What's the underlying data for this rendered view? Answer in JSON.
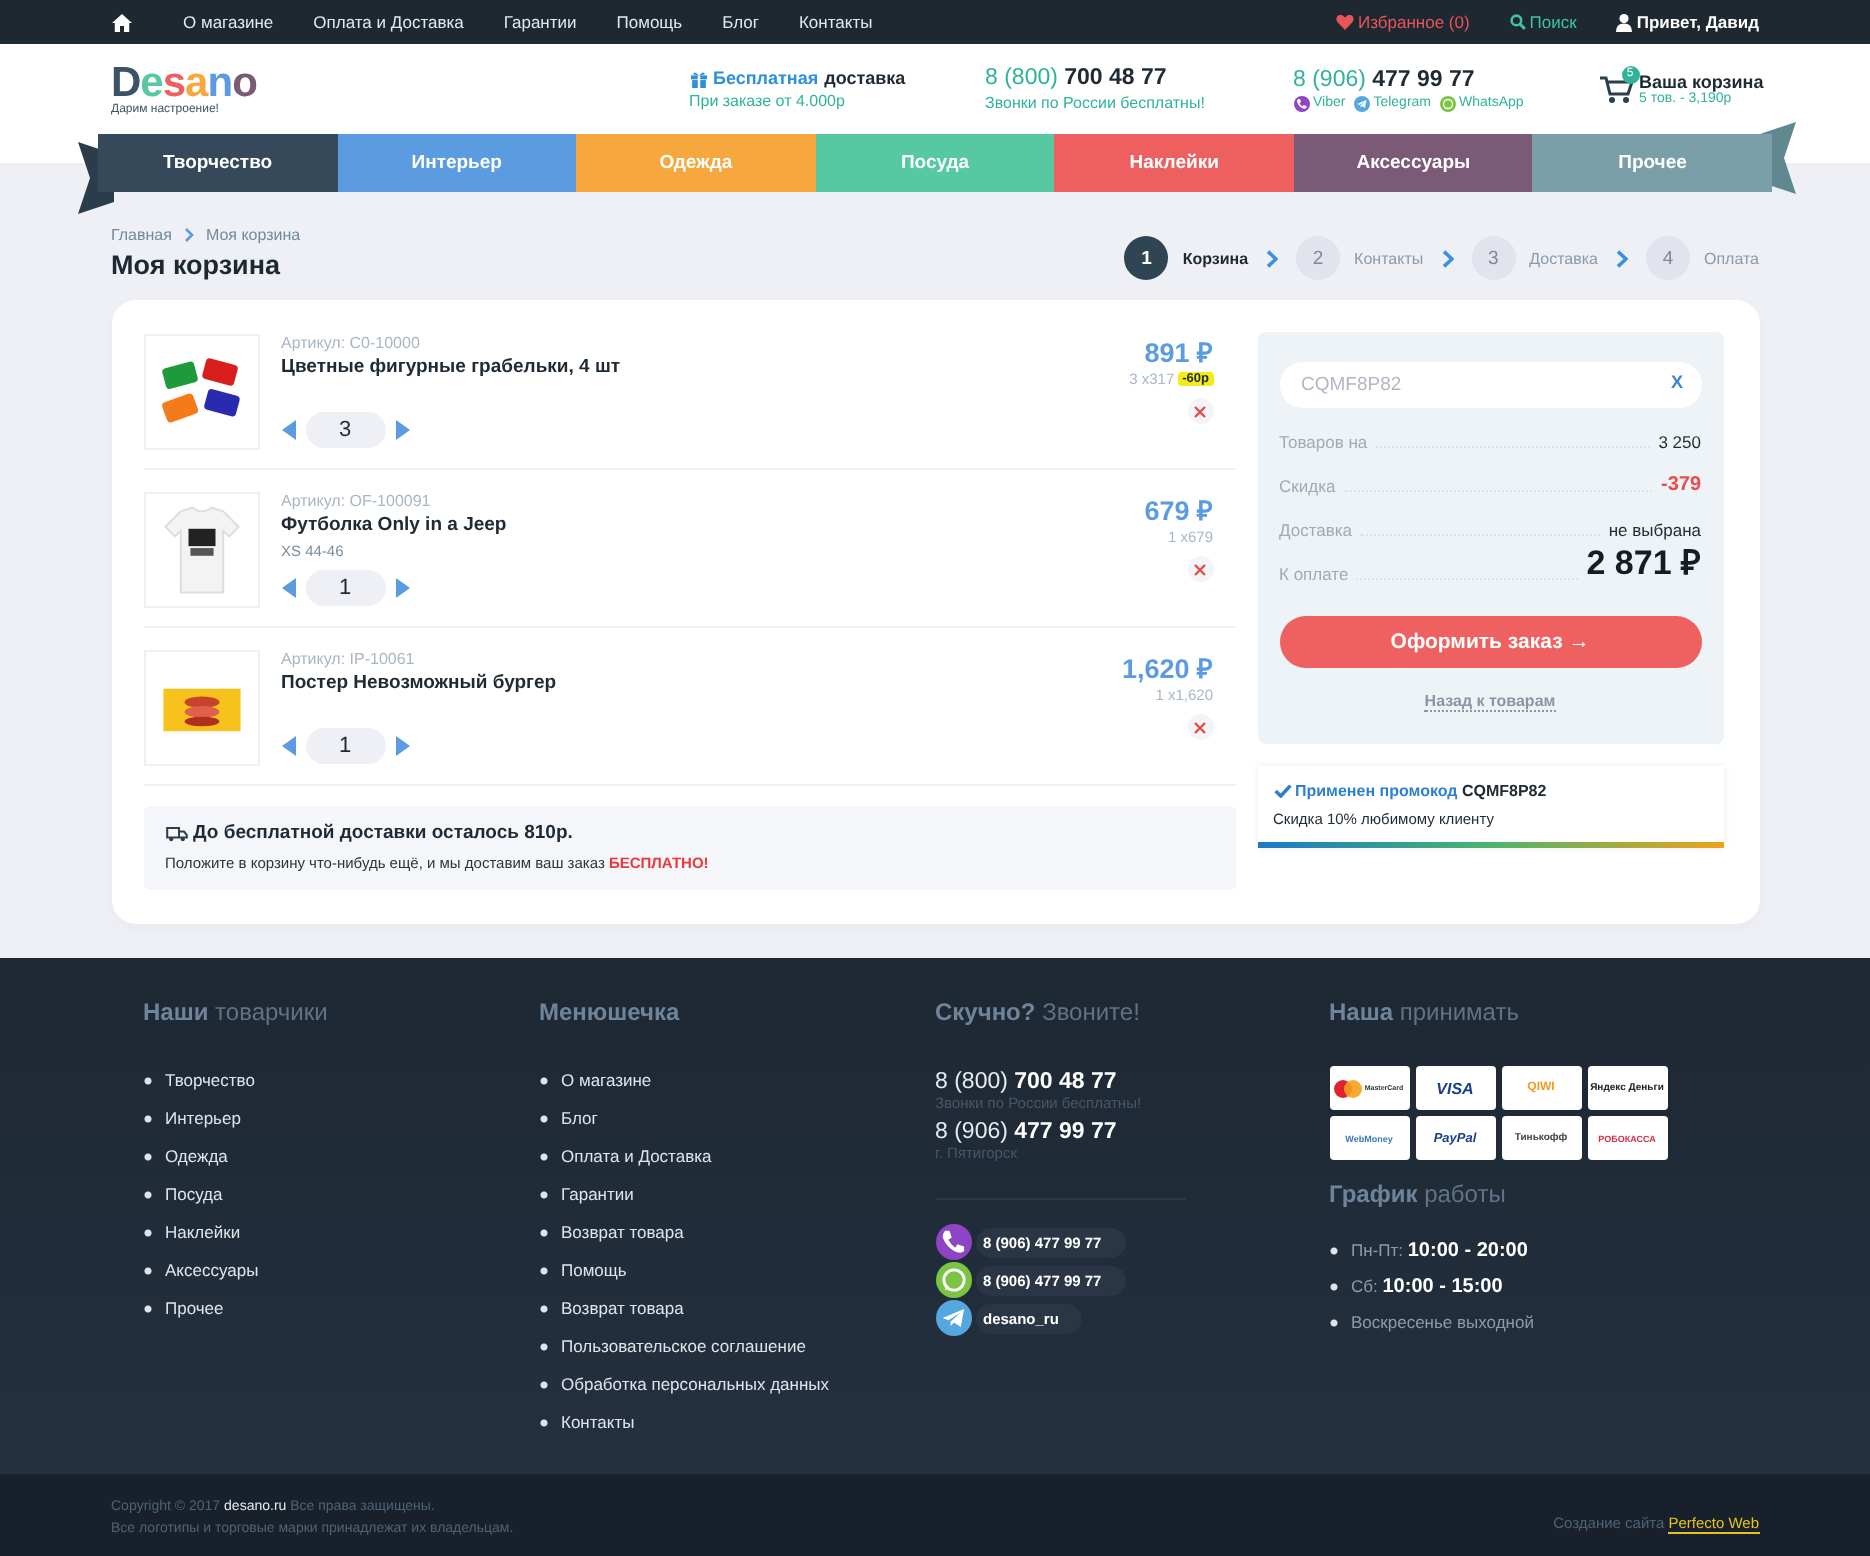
{
  "topbar": {
    "links": [
      {
        "label": "О магазине"
      },
      {
        "label": "Оплата и Доставка"
      },
      {
        "label": "Гарантии"
      },
      {
        "label": "Помощь"
      },
      {
        "label": "Блог"
      },
      {
        "label": "Контакты"
      }
    ],
    "favorites": "Избранное (0)",
    "search": "Поиск",
    "user": "Привет, Давид"
  },
  "header": {
    "logo": {
      "name": "Desano",
      "tagline": "Дарим настроение!"
    },
    "delivery": {
      "accent": "Бесплатная",
      "rest": "доставка",
      "note": "При заказе от 4.000р"
    },
    "phones": [
      {
        "number": "8 (800) **700 48 77**",
        "note": "Звонки по России бесплатны!"
      },
      {
        "number": "8 (906) **477 99 77**",
        "messengers": [
          {
            "kind": "viber",
            "label": "Viber"
          },
          {
            "kind": "telegram",
            "label": "Telegram"
          },
          {
            "kind": "whatsapp",
            "label": "WhatsApp"
          }
        ]
      }
    ],
    "cart": {
      "title": "Ваша корзина",
      "count": "5",
      "summary": "5 тов. - 3,190р"
    }
  },
  "categories": [
    {
      "label": "Творчество",
      "color": "#35495a"
    },
    {
      "label": "Интерьер",
      "color": "#5b9be0"
    },
    {
      "label": "Одежда",
      "color": "#f6a73d"
    },
    {
      "label": "Посуда",
      "color": "#56c8a2"
    },
    {
      "label": "Наклейки",
      "color": "#ee6060"
    },
    {
      "label": "Аксессуары",
      "color": "#7b5a77"
    },
    {
      "label": "Прочее",
      "color": "#7a9fa8"
    }
  ],
  "breadcrumbs": [
    {
      "label": "Главная"
    },
    {
      "label": "Моя корзина"
    }
  ],
  "page_title": "Моя корзина",
  "steps": [
    {
      "number": "1",
      "label": "Корзина",
      "selected": true
    },
    {
      "number": "2",
      "label": "Контакты",
      "selected": false
    },
    {
      "number": "3",
      "label": "Доставка",
      "selected": false
    },
    {
      "number": "4",
      "label": "Оплата",
      "selected": false
    }
  ],
  "cart_items": [
    {
      "sku": "Артикул: C0-10000",
      "name": "Цветные фигурные грабельки, 4 шт",
      "quantity": "3",
      "price": "891 ₽",
      "unit": "3 x317",
      "discount": "-60р"
    },
    {
      "sku": "Артикул: OF-100091",
      "name": "Футболка Only in a Jeep",
      "variant": "XS 44-46",
      "quantity": "1",
      "price": "679 ₽",
      "unit": "1 x679"
    },
    {
      "sku": "Артикул: IP-10061",
      "name": "Постер Невозможный бургер",
      "quantity": "1",
      "price": "1,620 ₽",
      "unit": "1 x1,620"
    }
  ],
  "free_delivery": {
    "title": "До бесплатной доставки осталось 810р.",
    "text": "Положите в корзину что-нибудь ещё, и мы доставим ваш заказ **БЕСПЛАТНО!**"
  },
  "summary": {
    "promo_value": "CQMF8P82",
    "clear": "X",
    "rows": [
      {
        "label": "Товаров на",
        "value": "3 250",
        "kind": "normal"
      },
      {
        "label": "Скидка",
        "value": "-379",
        "kind": "discount"
      },
      {
        "label": "Доставка",
        "value": "не выбрана",
        "kind": "normal"
      },
      {
        "label": "К оплате",
        "value": "2 871 ₽",
        "kind": "total"
      }
    ],
    "checkout": "Оформить заказ →",
    "back": "Назад к товарам"
  },
  "promo_notice": {
    "title": "Применен промокод **CQMF8P82**",
    "text": "Скидка 10% любимому клиенту"
  },
  "footer": {
    "products": {
      "title": "**Наши** товарчики",
      "items": [
        "Творчество",
        "Интерьер",
        "Одежда",
        "Посуда",
        "Наклейки",
        "Аксессуары",
        "Прочее"
      ]
    },
    "menu": {
      "title": "**Менюшечка**",
      "items": [
        "О магазине",
        "Блог",
        "Оплата и Доставка",
        "Гарантии",
        "Возврат товара",
        "Помощь",
        "Возврат товара",
        "Пользовательское соглашение",
        "Обработка персональных данных",
        "Контакты"
      ]
    },
    "contacts": {
      "title": "**Скучно?** Звоните!",
      "phones": [
        {
          "number": "8 (800) **700 48 77**",
          "note": "Звонки по России бесплатны!"
        },
        {
          "number": "8 (906) **477 99 77**",
          "note": "г. Пятигорск"
        }
      ],
      "messengers": [
        {
          "kind": "viber",
          "label": "8 (906) 477 99 77"
        },
        {
          "kind": "whatsapp",
          "label": "8 (906) 477 99 77"
        },
        {
          "kind": "telegram",
          "label": "desano_ru"
        }
      ]
    },
    "payments": {
      "title": "**Наша** принимать",
      "methods": [
        {
          "kind": "mastercard",
          "label": "MasterCard"
        },
        {
          "kind": "visa",
          "label": "VISA"
        },
        {
          "kind": "qiwi",
          "label": "QIWI"
        },
        {
          "kind": "yandex",
          "label": "Яндекс Деньги"
        },
        {
          "kind": "webmoney",
          "label": "WebMoney"
        },
        {
          "kind": "paypal",
          "label": "PayPal"
        },
        {
          "kind": "tinkoff",
          "label": "Тинькофф"
        },
        {
          "kind": "robokassa",
          "label": "РОБОКАССА"
        }
      ]
    },
    "schedule": {
      "title": "**График** работы",
      "items": [
        "Пн-Пт: **10:00 - 20:00**",
        "Сб: **10:00 - 15:00**",
        "Воскресенье выходной"
      ]
    }
  },
  "copyright": {
    "lines": [
      "Copyright © 2017 **desano.ru** Все права защищены.",
      "Все логотипы и торговые марки принадлежат их владельцам."
    ],
    "credit_label": "Создание сайта",
    "credit_link": "Perfecto Web"
  }
}
